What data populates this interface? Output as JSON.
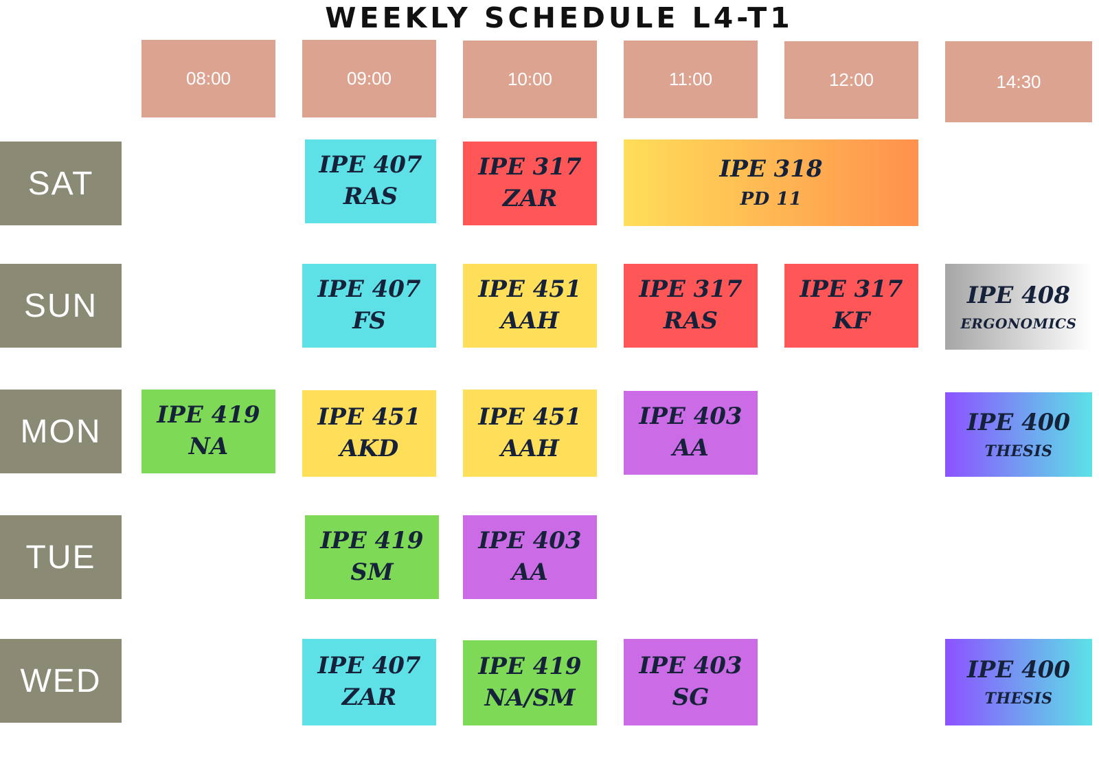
{
  "title": "WEEKLY SCHEDULE L4-T1",
  "times": [
    "08:00",
    "09:00",
    "10:00",
    "11:00",
    "12:00",
    "14:30"
  ],
  "days": [
    "SAT",
    "SUN",
    "MON",
    "TUE",
    "WED"
  ],
  "colors": {
    "header": "#dda391",
    "day": "#8b8a75",
    "cyan": "#5ee1e6",
    "red": "#ff5757",
    "yellow": "#ffde59",
    "green": "#7ed957",
    "purple": "#cb6ce6",
    "orange_gradient": [
      "#ffde59",
      "#ff914d"
    ],
    "gray_gradient": [
      "#a6a6a6",
      "#ffffff"
    ],
    "violet_gradient": [
      "#8c52ff",
      "#5ce1e6"
    ]
  },
  "classes": {
    "sat": [
      {
        "code": "IPE 407",
        "instructor": "RAS"
      },
      {
        "code": "IPE 317",
        "instructor": "ZAR"
      },
      {
        "code": "IPE 318",
        "instructor": "PD 11"
      }
    ],
    "sun": [
      {
        "code": "IPE 407",
        "instructor": "FS"
      },
      {
        "code": "IPE 451",
        "instructor": "AAH"
      },
      {
        "code": "IPE 317",
        "instructor": "RAS"
      },
      {
        "code": "IPE 317",
        "instructor": "KF"
      },
      {
        "code": "IPE 408",
        "instructor": "ERGONOMICS"
      }
    ],
    "mon": [
      {
        "code": "IPE 419",
        "instructor": "NA"
      },
      {
        "code": "IPE 451",
        "instructor": "AKD"
      },
      {
        "code": "IPE 451",
        "instructor": "AAH"
      },
      {
        "code": "IPE 403",
        "instructor": "AA"
      },
      {
        "code": "IPE 400",
        "instructor": "THESIS"
      }
    ],
    "tue": [
      {
        "code": "IPE 419",
        "instructor": "SM"
      },
      {
        "code": "IPE 403",
        "instructor": "AA"
      }
    ],
    "wed": [
      {
        "code": "IPE 407",
        "instructor": "ZAR"
      },
      {
        "code": "IPE 419",
        "instructor": "NA/SM"
      },
      {
        "code": "IPE 403",
        "instructor": "SG"
      },
      {
        "code": "IPE 400",
        "instructor": "THESIS"
      }
    ]
  }
}
